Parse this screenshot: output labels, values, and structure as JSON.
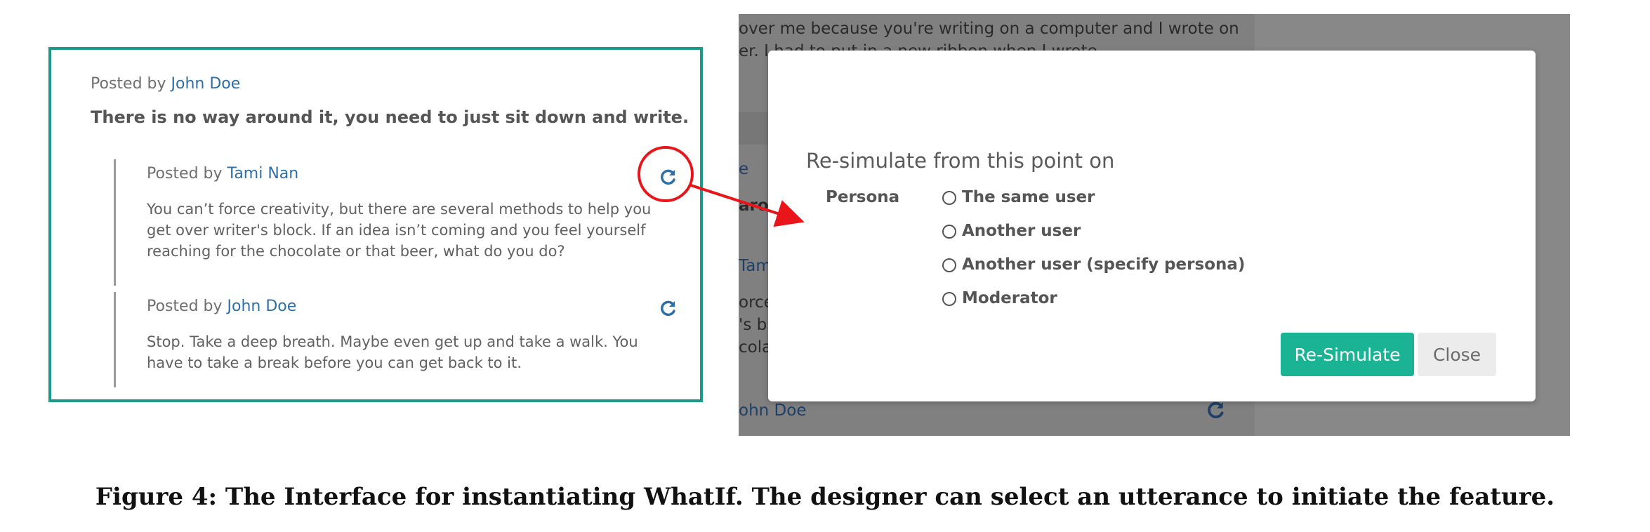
{
  "thread": {
    "top_post": {
      "posted_by": "Posted by",
      "author": "John Doe",
      "text": "There is no way around it, you need to just sit down and write."
    },
    "replies": [
      {
        "posted_by": "Posted by",
        "author": "Tami Nan",
        "text": "You can’t force creativity, but there are several methods to help you get over writer's block. If an idea isn’t coming and you feel yourself reaching for the chocolate or that beer, what do you do?",
        "icon": "refresh-icon",
        "highlighted": true
      },
      {
        "posted_by": "Posted by",
        "author": "John Doe",
        "text": "Stop. Take a deep breath. Maybe even get up and take a walk. You have to take a break before you can get back to it.",
        "icon": "refresh-icon",
        "highlighted": false
      }
    ]
  },
  "background": {
    "line1": "over me because you're writing on a computer and I wrote on",
    "line2": "er. I had to put in a new ribbon when I wrote",
    "frag_e": "e",
    "frag_aro": "aro",
    "frag_tam": "Tam",
    "frag_orce": "orce",
    "frag_sb": "'s b",
    "frag_cola": "cola",
    "frag_johndoe": "ohn Doe"
  },
  "modal": {
    "title": "Re-simulate from this point on",
    "persona_label": "Persona",
    "options": [
      "The same user",
      "Another user",
      "Another user (specify persona)",
      "Moderator"
    ],
    "resimulate_button": "Re-Simulate",
    "close_button": "Close"
  },
  "caption": "Figure 4: The Interface for instantiating WhatIf. The designer can select an utterance to initiate the feature.",
  "colors": {
    "teal_border": "#1b9a8a",
    "link_blue": "#2f6fa7",
    "primary_button": "#1ab394",
    "annotation_red": "#e8161a"
  }
}
